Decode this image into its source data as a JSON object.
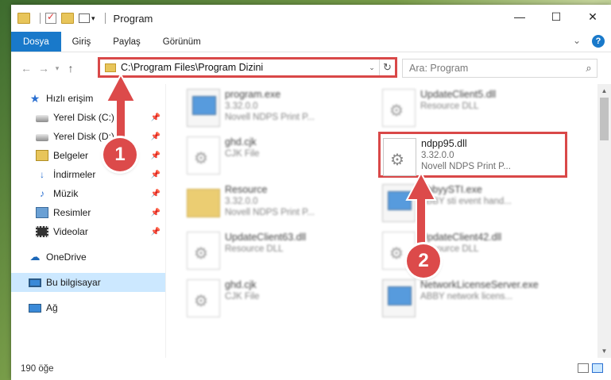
{
  "window": {
    "title": "Program"
  },
  "ribbon": {
    "tabs": [
      "Dosya",
      "Giriş",
      "Paylaş",
      "Görünüm"
    ]
  },
  "address": {
    "path": "C:\\Program Files\\Program Dizini"
  },
  "search": {
    "placeholder": "Ara: Program"
  },
  "sidebar": {
    "items": [
      {
        "label": "Hızlı erişim"
      },
      {
        "label": "Yerel Disk (C:)"
      },
      {
        "label": "Yerel Disk (D:)"
      },
      {
        "label": "Belgeler"
      },
      {
        "label": "İndirmeler"
      },
      {
        "label": "Müzik"
      },
      {
        "label": "Resimler"
      },
      {
        "label": "Videolar"
      },
      {
        "label": "OneDrive"
      },
      {
        "label": "Bu bilgisayar"
      },
      {
        "label": "Ağ"
      }
    ]
  },
  "files": [
    {
      "name": "program.exe",
      "line2": "3.32.0.0",
      "line3": "Novell NDPS Print P..."
    },
    {
      "name": "UpdateClient5.dll",
      "line2": "Resource DLL",
      "line3": ""
    },
    {
      "name": "ghd.cjk",
      "line2": "CJK File",
      "line3": ""
    },
    {
      "name": "ndpp95.dll",
      "line2": "3.32.0.0",
      "line3": "Novell NDPS Print P..."
    },
    {
      "name": "Resource",
      "line2": "3.32.0.0",
      "line3": "Novell NDPS Print P..."
    },
    {
      "name": "AbbyySTI.exe",
      "line2": "ABBY sti event hand...",
      "line3": ""
    },
    {
      "name": "UpdateClient63.dll",
      "line2": "Resource DLL",
      "line3": ""
    },
    {
      "name": "UpdateClient42.dll",
      "line2": "Resource DLL",
      "line3": ""
    },
    {
      "name": "ghd.cjk",
      "line2": "CJK File",
      "line3": ""
    },
    {
      "name": "NetworkLicenseServer.exe",
      "line2": "ABBY network licens...",
      "line3": ""
    }
  ],
  "status": {
    "count": "190 öğe"
  },
  "annotations": {
    "step1": "1",
    "step2": "2"
  }
}
